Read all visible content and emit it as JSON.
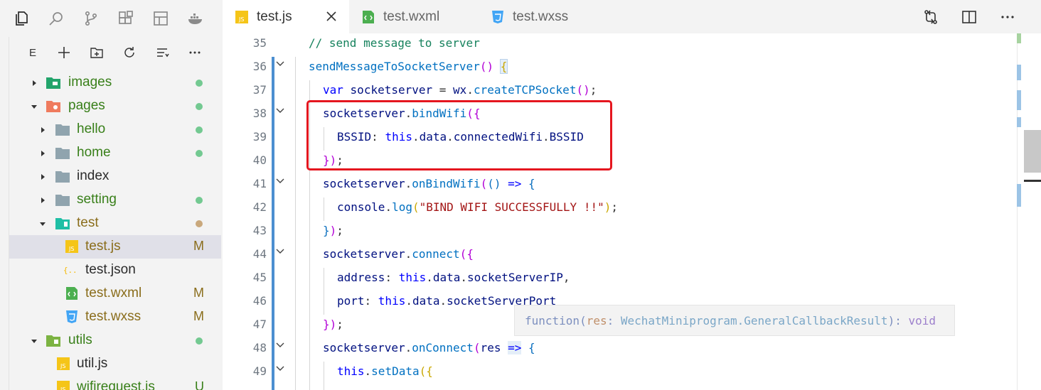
{
  "activity_bar": {
    "icons": [
      "files-icon",
      "search-icon",
      "source-control-icon",
      "extensions-icon",
      "layout-icon",
      "docker-icon"
    ]
  },
  "explorer": {
    "letter": "E",
    "toolbar_icons": [
      "new-file-icon",
      "new-folder-icon",
      "refresh-icon",
      "collapse-icon",
      "more-icon"
    ],
    "tree": [
      {
        "label": "images",
        "type": "folder",
        "expanded": false,
        "git": "dot-green"
      },
      {
        "label": "pages",
        "type": "folder",
        "expanded": true,
        "git": "dot-green"
      },
      {
        "label": "hello",
        "type": "folder",
        "expanded": false,
        "git": "dot-green"
      },
      {
        "label": "home",
        "type": "folder",
        "expanded": false,
        "git": "dot-green"
      },
      {
        "label": "index",
        "type": "folder",
        "expanded": false,
        "git": ""
      },
      {
        "label": "setting",
        "type": "folder",
        "expanded": false,
        "git": "dot-green"
      },
      {
        "label": "test",
        "type": "folder",
        "expanded": true,
        "git": "dot-olive"
      },
      {
        "label": "test.js",
        "type": "js",
        "git": "M",
        "selected": true
      },
      {
        "label": "test.json",
        "type": "json",
        "git": ""
      },
      {
        "label": "test.wxml",
        "type": "wxml",
        "git": "M"
      },
      {
        "label": "test.wxss",
        "type": "wxss",
        "git": "M"
      },
      {
        "label": "utils",
        "type": "folder",
        "expanded": true,
        "git": "dot-green"
      },
      {
        "label": "util.js",
        "type": "js",
        "git": ""
      },
      {
        "label": "wifirequest.js",
        "type": "js",
        "git": "U"
      }
    ]
  },
  "tabs": [
    {
      "label": "test.js",
      "active": true
    },
    {
      "label": "test.wxml",
      "active": false
    },
    {
      "label": "test.wxss",
      "active": false
    }
  ],
  "editor": {
    "line_numbers": [
      "35",
      "36",
      "37",
      "38",
      "39",
      "40",
      "41",
      "42",
      "43",
      "44",
      "45",
      "46",
      "47",
      "48",
      "49"
    ],
    "tooltip": {
      "prefix": "function(",
      "param": "res",
      "colon": ": ",
      "type": "WechatMiniprogram.GeneralCallbackResult",
      "suffix": "): ",
      "ret": "void"
    }
  },
  "colors": {
    "highlight_box": "#e5161f",
    "git_bar": "#4c8fd0",
    "modified": "#8a6d1b",
    "added_dot": "#73c991"
  }
}
